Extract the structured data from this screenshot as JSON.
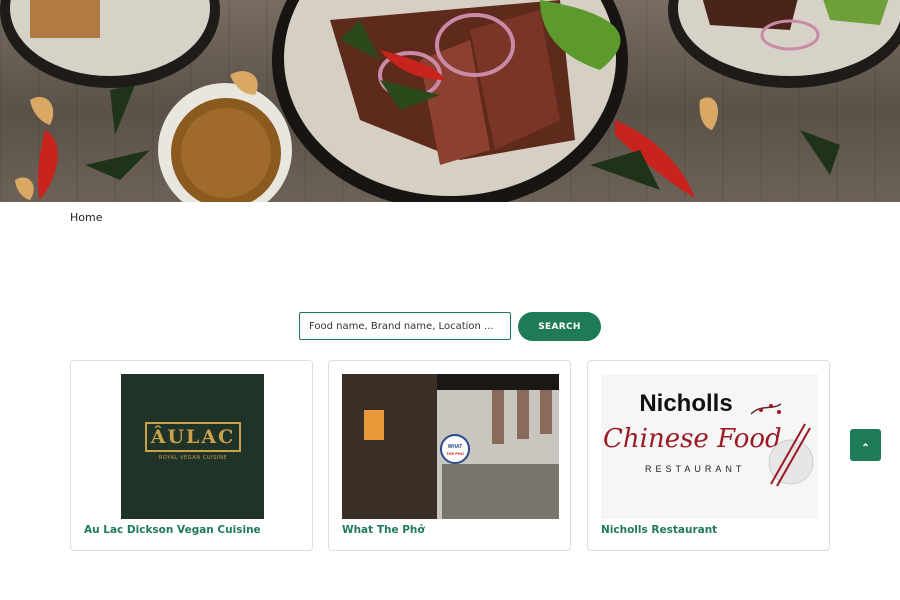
{
  "breadcrumb": {
    "home_label": "Home"
  },
  "search": {
    "placeholder": "Food name, Brand name, Location ...",
    "button_label": "SEARCH"
  },
  "restaurants": [
    {
      "name": "Au Lac Dickson Vegan Cuisine",
      "logo_text": "ÂULAC",
      "logo_subtext": "ROYAL VEGAN CUISINE"
    },
    {
      "name": "What The Phở",
      "sign_text": "WHAT THE PHO"
    },
    {
      "name": "Nicholls Restaurant",
      "logo_title": "Nicholls",
      "logo_script": "Chinese Food",
      "logo_subtitle": "RESTAURANT"
    }
  ],
  "colors": {
    "accent": "#1f7a57",
    "logo_red": "#9c1a23",
    "logo_gold": "#c9a24a"
  },
  "icons": {
    "back_to_top": "chevron-up-icon"
  }
}
